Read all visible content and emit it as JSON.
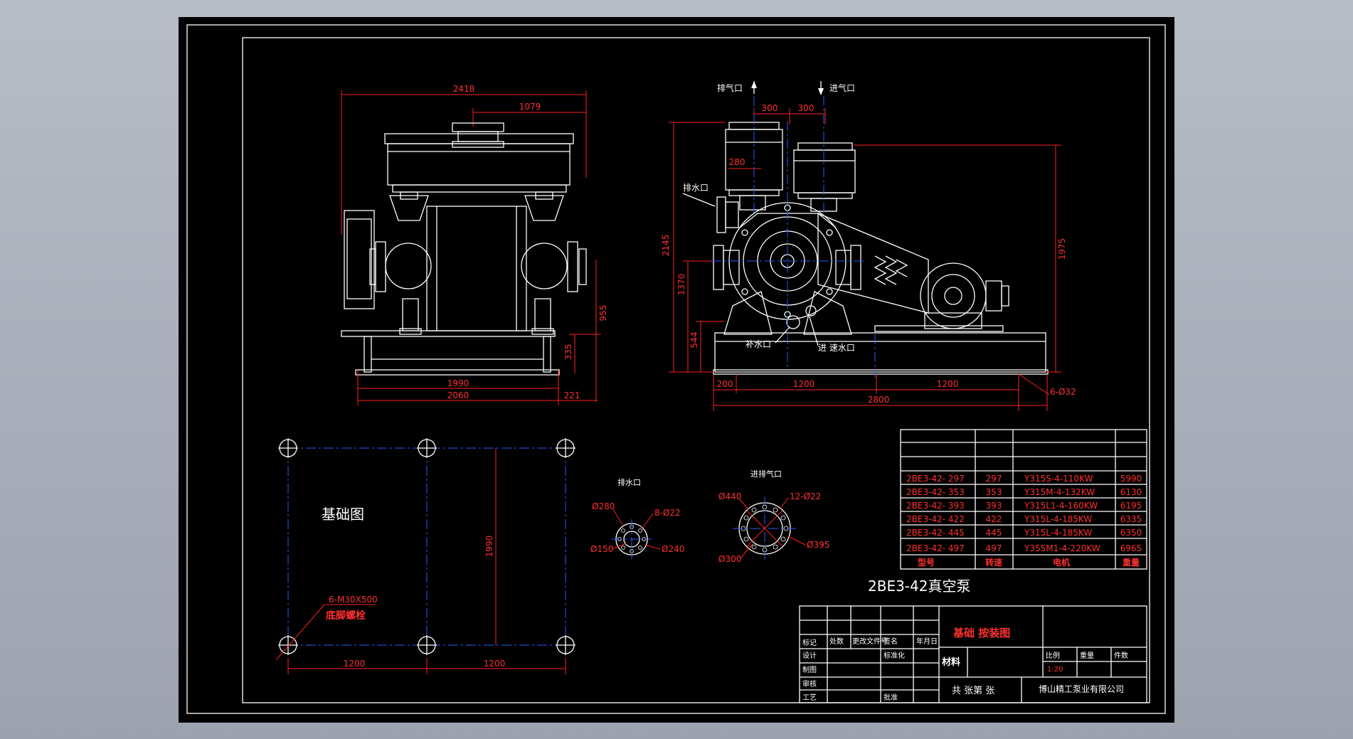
{
  "drawing": {
    "title": "2BE3-42真空泵",
    "foundation_title": "基础图",
    "callouts": {
      "exhaust_top": "排气口",
      "intake_top": "进气口",
      "drain": "排水口",
      "water_supply": "补水口",
      "water_inlet": "进 速水口",
      "anchor_bolt_spec": "6-M30X500",
      "anchor_bolt_name": "底脚螺栓",
      "holes": "6-Ø32"
    },
    "dims_left": [
      "2418",
      "1079",
      "955",
      "335",
      "1990",
      "2060",
      "221"
    ],
    "dims_right": [
      "300",
      "300",
      "280",
      "2145",
      "1370",
      "544",
      "1975",
      "200",
      "1200",
      "1200",
      "2800"
    ],
    "foundation_dims": [
      "1990",
      "1200",
      "1200"
    ],
    "flange_drain": {
      "title": "排水口",
      "labels": [
        "Ø280",
        "8-Ø22",
        "Ø150",
        "Ø240"
      ]
    },
    "flange_gas": {
      "title": "进排气口",
      "labels": [
        "Ø440",
        "12-Ø22",
        "Ø395",
        "Ø300"
      ]
    }
  },
  "model_table": {
    "headers": [
      "型号",
      "转速",
      "电机",
      "重量"
    ],
    "rows": [
      [
        "2BE3-42-  297",
        "297",
        "Y315S-4-110KW",
        "5990"
      ],
      [
        "2BE3-42-  353",
        "353",
        "Y315M-4-132KW",
        "6130"
      ],
      [
        "2BE3-42-  393",
        "393",
        "Y315L1-4-160KW",
        "6195"
      ],
      [
        "2BE3-42-  422",
        "422",
        "Y315L-4-185KW",
        "6335"
      ],
      [
        "2BE3-42-  445",
        "445",
        "Y315L-4-185KW",
        "6350"
      ],
      [
        "2BE3-42-  497",
        "497",
        "Y355M1-4-220KW",
        "6965"
      ]
    ]
  },
  "title_block": {
    "drawing_name": "基础 按装图",
    "material_label": "材料",
    "scale_label": "比例",
    "scale_value": "1:20",
    "weight_label": "重量",
    "pieces_label": "件数",
    "sheets": "共  张第  张",
    "company": "博山精工泵业有限公司",
    "rev_headers": [
      "标记",
      "处数",
      "更改文件号",
      "签名",
      "年月日"
    ],
    "roles": [
      "设计",
      "制图",
      "审核",
      "工艺"
    ],
    "role_mid": [
      "标准化",
      "批准"
    ]
  },
  "colors": {
    "background": "#a9afba",
    "sheet": "#000000",
    "line": "#ffffff",
    "dimension": "#ff2020",
    "centerline": "#2a5cff"
  }
}
